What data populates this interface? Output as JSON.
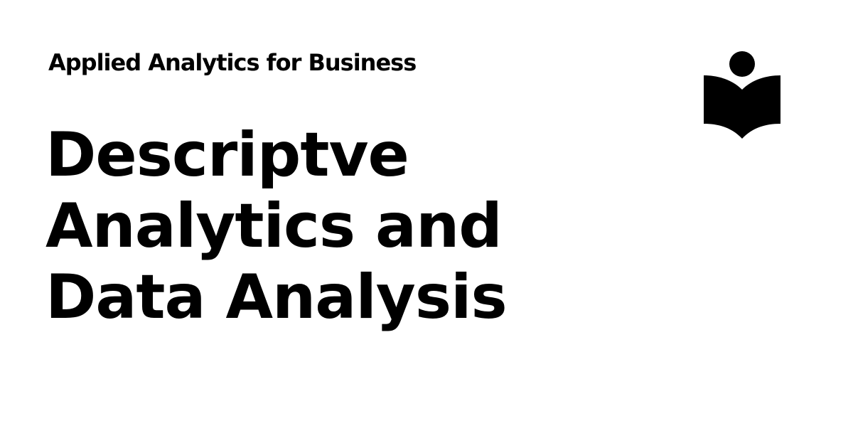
{
  "header": {
    "subtitle": "Applied Analytics for Business"
  },
  "main": {
    "title_lines": [
      "Descriptve",
      "Analytics and",
      "Data Analysis"
    ]
  },
  "logo": {
    "icon": "person-reading-book-icon",
    "color": "#000000"
  },
  "theme": {
    "background": "#ffffff",
    "text": "#000000"
  }
}
